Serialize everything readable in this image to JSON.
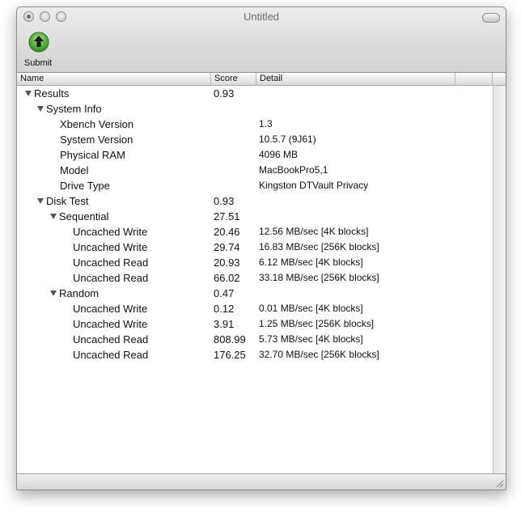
{
  "window": {
    "title": "Untitled"
  },
  "toolbar": {
    "submit_label": "Submit",
    "submit_icon": "up-arrow-icon",
    "submit_color": "#2e9a20"
  },
  "columns": {
    "name": "Name",
    "score": "Score",
    "detail": "Detail"
  },
  "rows": [
    {
      "name": "Results",
      "level": 0,
      "expanded": true,
      "score": "0.93",
      "detail": ""
    },
    {
      "name": "System Info",
      "level": 1,
      "expanded": true,
      "score": "",
      "detail": ""
    },
    {
      "name": "Xbench Version",
      "level": 2,
      "score": "",
      "detail": "1.3"
    },
    {
      "name": "System Version",
      "level": 2,
      "score": "",
      "detail": "10.5.7 (9J61)"
    },
    {
      "name": "Physical RAM",
      "level": 2,
      "score": "",
      "detail": "4096 MB"
    },
    {
      "name": "Model",
      "level": 2,
      "score": "",
      "detail": "MacBookPro5,1"
    },
    {
      "name": "Drive Type",
      "level": 2,
      "score": "",
      "detail": "Kingston DTVault Privacy"
    },
    {
      "name": "Disk Test",
      "level": 1,
      "expanded": true,
      "score": "0.93",
      "detail": ""
    },
    {
      "name": "Sequential",
      "level": 2,
      "expanded": true,
      "score": "27.51",
      "detail": ""
    },
    {
      "name": "Uncached Write",
      "level": 3,
      "score": "20.46",
      "detail": "12.56 MB/sec [4K blocks]"
    },
    {
      "name": "Uncached Write",
      "level": 3,
      "score": "29.74",
      "detail": "16.83 MB/sec [256K blocks]"
    },
    {
      "name": "Uncached Read",
      "level": 3,
      "score": "20.93",
      "detail": "6.12 MB/sec [4K blocks]"
    },
    {
      "name": "Uncached Read",
      "level": 3,
      "score": "66.02",
      "detail": "33.18 MB/sec [256K blocks]"
    },
    {
      "name": "Random",
      "level": 2,
      "expanded": true,
      "score": "0.47",
      "detail": ""
    },
    {
      "name": "Uncached Write",
      "level": 3,
      "score": "0.12",
      "detail": "0.01 MB/sec [4K blocks]"
    },
    {
      "name": "Uncached Write",
      "level": 3,
      "score": "3.91",
      "detail": "1.25 MB/sec [256K blocks]"
    },
    {
      "name": "Uncached Read",
      "level": 3,
      "score": "808.99",
      "detail": "5.73 MB/sec [4K blocks]"
    },
    {
      "name": "Uncached Read",
      "level": 3,
      "score": "176.25",
      "detail": "32.70 MB/sec [256K blocks]"
    }
  ]
}
